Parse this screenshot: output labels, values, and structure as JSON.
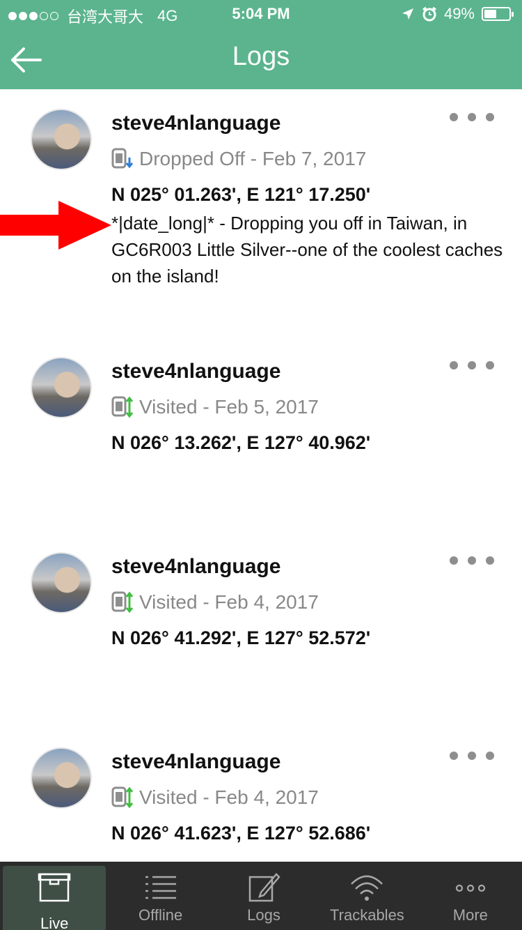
{
  "status_bar": {
    "carrier": "台湾大哥大",
    "network": "4G",
    "time": "5:04 PM",
    "battery": "49%",
    "battery_level": 0.49
  },
  "header": {
    "title": "Logs"
  },
  "logs": [
    {
      "user": "steve4nlanguage",
      "action": "Dropped Off - Feb 7, 2017",
      "coords": "N 025° 01.263', E 121° 17.250'",
      "note": "*|date_long|* - Dropping you off in Taiwan, in GC6R003 Little Silver--one of the coolest caches on the island!",
      "icon": "dropped-off-icon"
    },
    {
      "user": "steve4nlanguage",
      "action": "Visited - Feb 5, 2017",
      "coords": "N 026° 13.262', E 127° 40.962'",
      "icon": "visited-icon"
    },
    {
      "user": "steve4nlanguage",
      "action": "Visited - Feb 4, 2017",
      "coords": "N 026° 41.292', E 127° 52.572'",
      "icon": "visited-icon"
    },
    {
      "user": "steve4nlanguage",
      "action": "Visited - Feb 4, 2017",
      "coords": "N 026° 41.623', E 127° 52.686'",
      "icon": "visited-icon"
    }
  ],
  "tabs": [
    {
      "label": "Live",
      "icon": "box-icon",
      "active": true
    },
    {
      "label": "Offline",
      "icon": "list-icon"
    },
    {
      "label": "Logs",
      "icon": "edit-icon"
    },
    {
      "label": "Trackables",
      "icon": "wifi-icon"
    },
    {
      "label": "More",
      "icon": "more-icon"
    }
  ],
  "colors": {
    "header": "#5bb48e",
    "tabbar": "#2c2c2c",
    "arrow": "#ff0000",
    "dropped_blue": "#2d7fd6",
    "visited_green": "#3fbf3f"
  }
}
